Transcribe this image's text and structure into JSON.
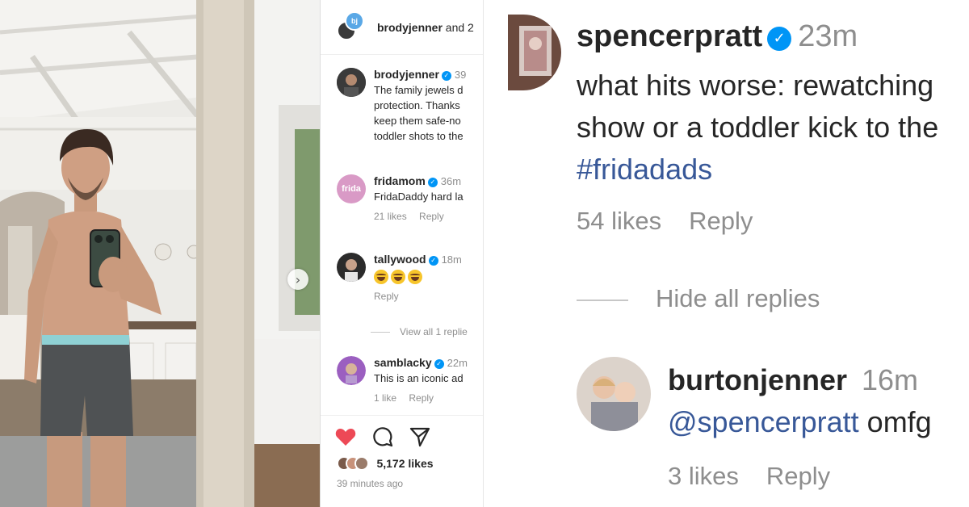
{
  "post": {
    "header_user": "brodyjenner",
    "header_suffix": "and 2",
    "head_avatar_badge": "bj",
    "comments": [
      {
        "user": "brodyjenner",
        "time": "39",
        "lines": [
          "The family jewels d",
          "protection. Thanks",
          "keep them safe-no",
          "toddler shots to the"
        ]
      },
      {
        "user": "fridamom",
        "time": "36m",
        "avatar_text": "frida",
        "lines": [
          "FridaDaddy hard la"
        ],
        "likes": "21 likes",
        "reply": "Reply"
      },
      {
        "user": "tallywood",
        "time": "18m",
        "reply": "Reply"
      },
      {
        "user": "samblacky",
        "time": "22m",
        "lines": [
          "This is an iconic ad"
        ],
        "likes": "1 like",
        "reply": "Reply"
      }
    ],
    "view_replies": "View all 1 replie",
    "likes_count": "5,172 likes",
    "time_ago": "39 minutes ago",
    "icons": [
      "heart-icon",
      "comment-icon",
      "share-icon",
      "chevron-right-icon"
    ],
    "colors": {
      "like_red": "#ed4956",
      "verified_blue": "#0095f6",
      "muted": "#8e8e8e"
    }
  },
  "zoom": {
    "user": "spencerpratt",
    "time": "23m",
    "text_line1": "what hits worse: rewatching",
    "text_line2": "show or a toddler kick to the",
    "hashtag": "#fridadads",
    "likes": "54 likes",
    "reply": "Reply",
    "hide_replies": "Hide all replies",
    "reply_user": "burtonjenner",
    "reply_time": "16m",
    "reply_mention": "@spencerpratt",
    "reply_text": "omfg",
    "reply_likes": "3 likes",
    "reply_reply": "Reply",
    "link_color": "#385898"
  }
}
